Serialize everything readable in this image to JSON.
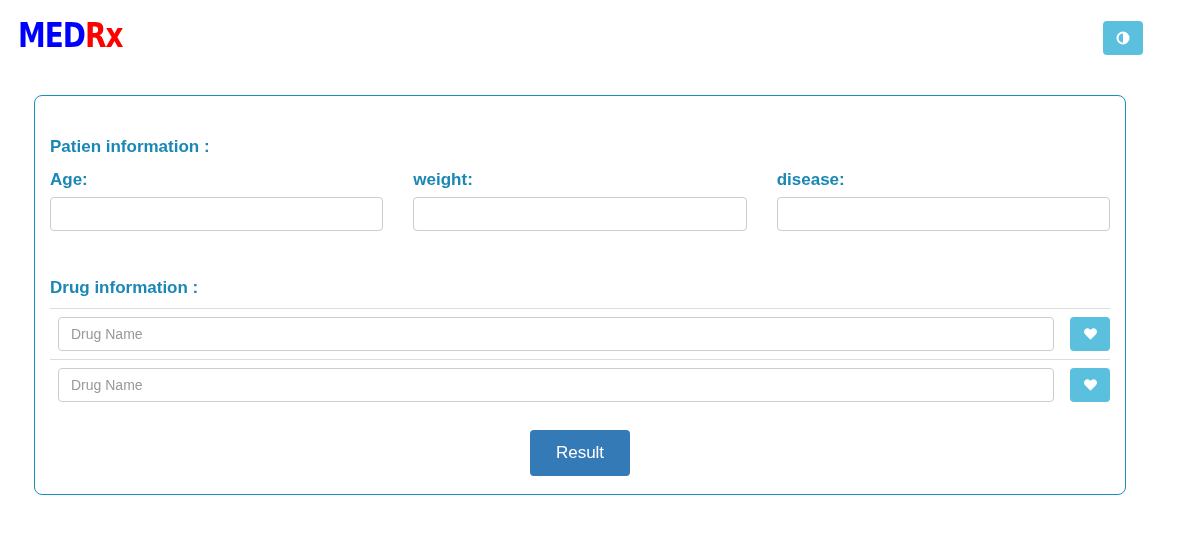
{
  "logo": [
    {
      "text": "MED",
      "color": "#0000ff"
    },
    {
      "text": "Rx",
      "color": "#ff0000"
    }
  ],
  "patient": {
    "heading": "Patien information :",
    "fields": [
      {
        "label": "Age:"
      },
      {
        "label": "weight:"
      },
      {
        "label": "disease:"
      }
    ]
  },
  "drugs": {
    "heading": "Drug information :",
    "rows": [
      {
        "placeholder": "Drug Name"
      },
      {
        "placeholder": "Drug Name"
      }
    ]
  },
  "submit": "Result"
}
